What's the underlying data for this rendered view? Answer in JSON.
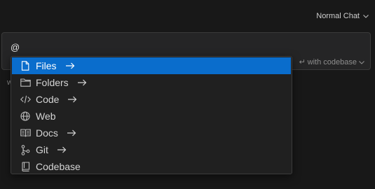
{
  "header": {
    "mode_label": "Normal Chat"
  },
  "input": {
    "value": "@",
    "codebase_hint": "with codebase",
    "enter_symbol": "↵"
  },
  "background": {
    "partial_text": "w"
  },
  "mention_menu": {
    "items": [
      {
        "label": "Files",
        "icon": "file-icon",
        "has_arrow": true,
        "active": true
      },
      {
        "label": "Folders",
        "icon": "folder-icon",
        "has_arrow": true,
        "active": false
      },
      {
        "label": "Code",
        "icon": "code-icon",
        "has_arrow": true,
        "active": false
      },
      {
        "label": "Web",
        "icon": "globe-icon",
        "has_arrow": false,
        "active": false
      },
      {
        "label": "Docs",
        "icon": "book-icon",
        "has_arrow": true,
        "active": false
      },
      {
        "label": "Git",
        "icon": "git-branch-icon",
        "has_arrow": true,
        "active": false
      },
      {
        "label": "Codebase",
        "icon": "repo-icon",
        "has_arrow": false,
        "active": false
      }
    ]
  },
  "colors": {
    "background": "#181818",
    "accent": "#0a6dcc",
    "menu_bg": "#202020"
  }
}
